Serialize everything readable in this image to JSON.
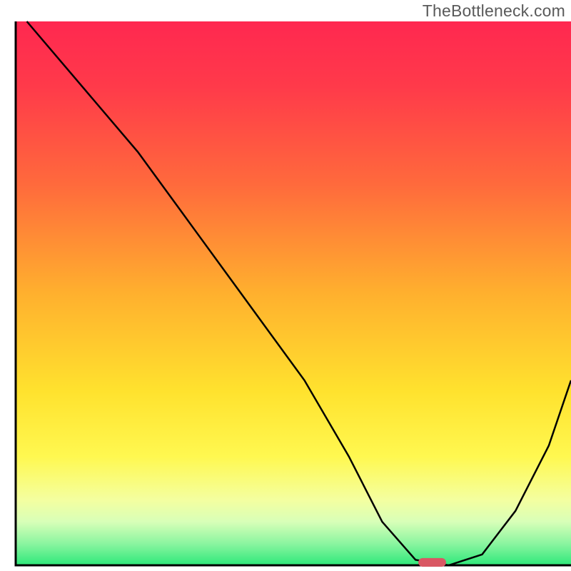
{
  "watermark": "TheBottleneck.com",
  "chart_data": {
    "type": "line",
    "title": "",
    "xlabel": "",
    "ylabel": "",
    "xlim": [
      0,
      100
    ],
    "ylim": [
      0,
      100
    ],
    "x": [
      2,
      12,
      22,
      32,
      42,
      52,
      60,
      66,
      72,
      78,
      84,
      90,
      96,
      100
    ],
    "values": [
      100,
      88,
      76,
      62,
      48,
      34,
      20,
      8,
      1,
      0,
      2,
      10,
      22,
      34
    ],
    "marker": {
      "x": 75,
      "y": 0,
      "w": 5,
      "h": 1.6,
      "color": "#d95763"
    },
    "gradient_stops": [
      {
        "pct": 0,
        "color": "#ff2850"
      },
      {
        "pct": 12,
        "color": "#ff3a4a"
      },
      {
        "pct": 30,
        "color": "#ff6a3c"
      },
      {
        "pct": 50,
        "color": "#ffb02e"
      },
      {
        "pct": 68,
        "color": "#ffe22e"
      },
      {
        "pct": 80,
        "color": "#fff850"
      },
      {
        "pct": 88,
        "color": "#f4ffa0"
      },
      {
        "pct": 92,
        "color": "#d8ffb8"
      },
      {
        "pct": 96,
        "color": "#8bf5a0"
      },
      {
        "pct": 100,
        "color": "#2ee87a"
      }
    ]
  }
}
